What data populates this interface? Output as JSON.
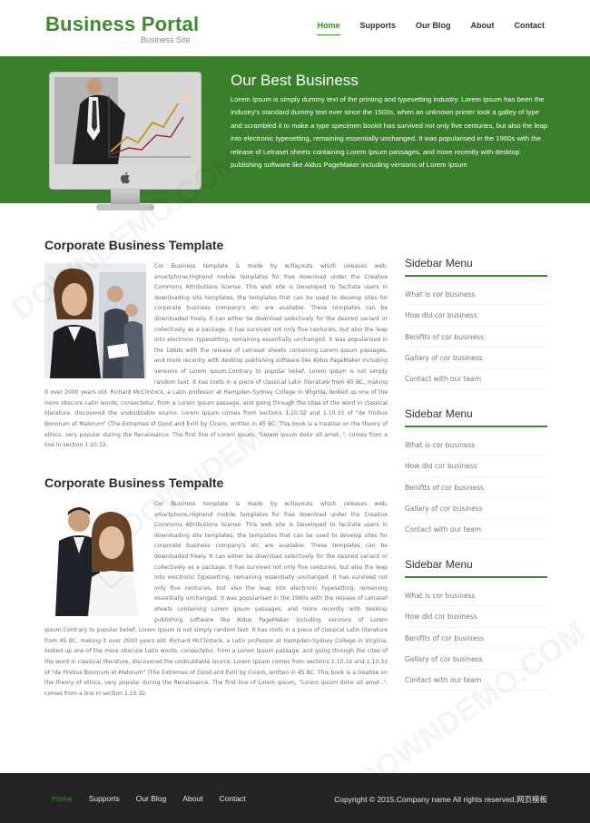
{
  "header": {
    "logo": "Business Portal",
    "logo_sub": "Business Site",
    "nav": [
      "Home",
      "Supports",
      "Our Blog",
      "About",
      "Contact"
    ]
  },
  "banner": {
    "title": "Our Best Business",
    "text": "Lorem Ipsum is simply dummy text of the printing and typesetting industry. Lorem Ipsum has been the industry's standard dummy text ever since the 1500s, when an unknown printer took a galley of type and scrambled it to make a type specimen bookit has survived not only five centuries, but also the leap into electronic typesetting, remaining essentially unchanged. It was popularised in the 1960s with the release of Letraset sheets containing Lorem Ipsum passages, and more recently with desktop publishing software like Aldus PageMaker including versions of Lorem Ipsum"
  },
  "articles": [
    {
      "title": "Corporate Business Template",
      "body": "Cor Business template is made by w3layouts which releases web, smartphone,Highend mobile templates for free download under the Creative Commons Attributions license. This web site is Developed to faciliate users in downloading site templates, the templates that can be used to develop sites for corporate business company's etc are available. These templates can be downloaded freely. It can either be download selectively for the desired variant or collectively as a package. It has survived not only five centuries, but also the leap into electronic typesetting, remaining essentially unchanged. It was popularised in the 1960s with the release of Letraset sheets containing Lorem Ipsum passages, and more recently with desktop publishing software like Aldus PageMaker including versions of Lorem Ipsum.Contrary to popular belief, Lorem Ipsum is not simply random text. It has roots in a piece of classical Latin literature from 45 BC, making it over 2000 years old. Richard McClintock, a Latin professor at Hampden-Sydney College in Virginia, looked up one of the more obscure Latin words, consectetur, from a Lorem Ipsum passage, and going through the cites of the word in classical literature, discovered the undoubtable source. Lorem Ipsum comes from sections 1.10.32 and 1.10.33 of \"de Finibus Bonorum et Malorum\" (The Extremes of Good and Evil) by Cicero, written in 45 BC. This book is a treatise on the theory of ethics, very popular during the Renaissance. The first line of Lorem Ipsum, \"Lorem ipsum dolor sit amet..\", comes from a line in section 1.10.32."
    },
    {
      "title": "Corporate Business Tempalte",
      "body": "Cor Business template is made by w3layouts which releases web, smartphone,Highend mobile templates for free download under the Creative Commons Attributions license. This web site is Developed to faciliate users in downloading site templates, the templates that can be used to develop sites for corporate business company's etc are available. These templates can be downloaded freely. It can either be download selectively for the desired variant or collectively as a package. It has survived not only five centuries, but also the leap into electronic typesetting, remaining essentially unchanged. It has survived not only five centuries, but also the leap into electronic typesetting, remaining essentially unchanged. It was popularised in the 1960s with the release of Letraset sheets containing Lorem Ipsum passages, and more recently with desktop publishing software like Aldus PageMaker including versions of Lorem Ipsum.Contrary to popular belief, Lorem Ipsum is not simply random text. It has roots in a piece of classical Latin literature from 45 BC, making it over 2000 years old. Richard McClintock, a Latin professor at Hampden-Sydney College in Virginia, looked up one of the more obscure Latin words, consectetur, from a Lorem Ipsum passage, and going through the cites of the word in classical literature, discovered the undoubtable source. Lorem Ipsum comes from sections 1.10.32 and 1.10.33 of \"de Finibus Bonorum et Malorum\" (The Extremes of Good and Evil) by Cicero, written in 45 BC. This book is a treatise on the theory of ethics, very popular during the Renaissance. The first line of Lorem Ipsum, \"Lorem ipsum dolor sit amet..\", comes from a line in section 1.10.32."
    }
  ],
  "sidebars": [
    {
      "title": "Sidebar Menu",
      "items": [
        "What is cor business",
        "How did cor business",
        "Benifits of cor business",
        "Gallary of cor business",
        "Contact with our team"
      ]
    },
    {
      "title": "Sidebar Menu",
      "items": [
        "What is cor business",
        "How did cor business",
        "Benifits of cor business",
        "Gallary of cor business",
        "Contact with our team"
      ]
    },
    {
      "title": "Sidebar Menu",
      "items": [
        "What is cor business",
        "How did cor business",
        "Benifits of cor business",
        "Gallary of cor business",
        "Contact with our team"
      ]
    }
  ],
  "footer": {
    "nav": [
      "Home",
      "Supports",
      "Our Blog",
      "About",
      "Contact"
    ],
    "copyright": "Copyright © 2015.Company name All rights reserved.网页模板"
  },
  "watermark": "DOWNDEMO.COM",
  "colors": {
    "brand_green": "#3d8b2e",
    "banner_green": "#3a7f2b",
    "footer_bg": "#242424"
  },
  "icons": [
    "apple-logo-icon"
  ]
}
